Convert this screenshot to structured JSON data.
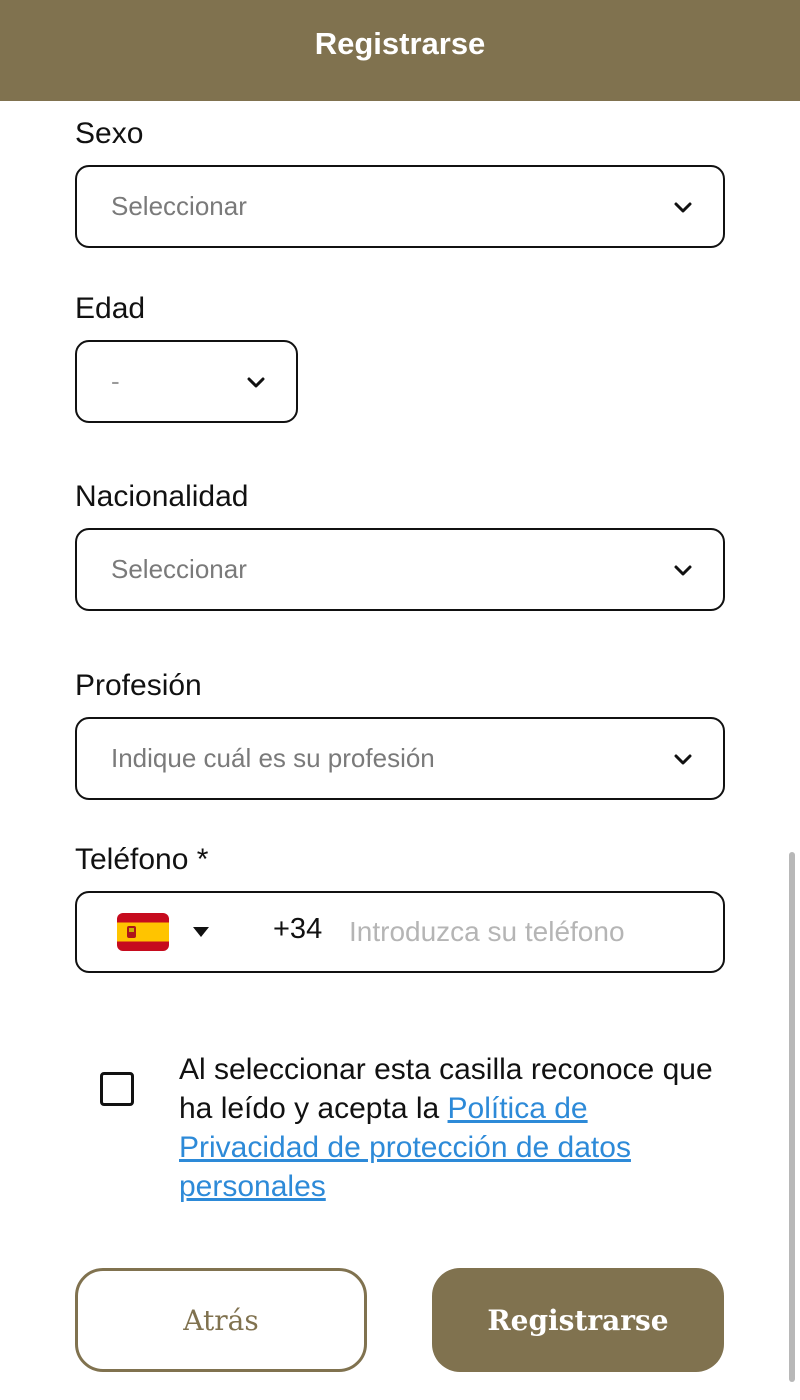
{
  "header": {
    "title": "Registrarse"
  },
  "form": {
    "sexo": {
      "label": "Sexo",
      "value": "Seleccionar"
    },
    "edad": {
      "label": "Edad",
      "value": "-"
    },
    "nacionalidad": {
      "label": "Nacionalidad",
      "value": "Seleccionar"
    },
    "profesion": {
      "label": "Profesión",
      "value": "Indique cuál es su profesión"
    },
    "telefono": {
      "label": "Teléfono *",
      "country_flag": "spain-flag-icon",
      "dial_code": "+34",
      "placeholder": "Introduzca su teléfono",
      "value": ""
    }
  },
  "consent": {
    "checked": false,
    "text": "Al seleccionar esta casilla reconoce que ha leído y acepta la ",
    "link_text": "Política de Privacidad de protección de datos personales"
  },
  "buttons": {
    "back": "Atrás",
    "submit": "Registrarse"
  },
  "colors": {
    "brand": "#80724f",
    "link": "#2d8ad8",
    "border": "#111111"
  }
}
